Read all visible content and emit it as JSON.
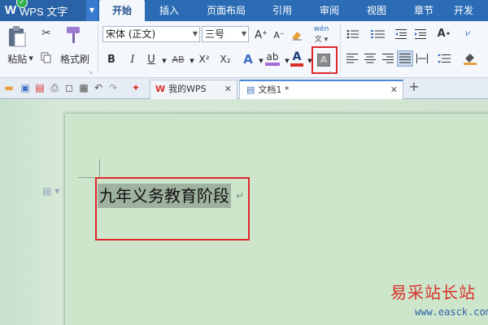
{
  "app": {
    "title": "WPS 文字",
    "logo": "W"
  },
  "menu_tabs": [
    "开始",
    "插入",
    "页面布局",
    "引用",
    "审阅",
    "视图",
    "章节",
    "开发"
  ],
  "active_tab": "开始",
  "ribbon": {
    "paste_label": "粘贴",
    "format_painter_label": "格式刷",
    "font_name": "宋体 (正文)",
    "font_size": "三号",
    "grow_font": "A⁺",
    "shrink_font": "A⁻",
    "pinyin_label": "wén",
    "bold": "B",
    "italic": "I",
    "underline": "U",
    "strikethrough": "AB",
    "superscript": "X²",
    "subscript": "X₂",
    "text_effect": "A",
    "highlight": "ab",
    "font_color": "A",
    "char_shading": "A"
  },
  "doc_tabs": [
    {
      "label": "我的WPS",
      "active": false
    },
    {
      "label": "文档1 *",
      "active": true
    }
  ],
  "add_tab": "+",
  "document": {
    "selected_text": "九年义务教育阶段",
    "paragraph_mark": "↵"
  },
  "watermark": {
    "title": "易采站长站",
    "url": "www.easck.com"
  },
  "colors": {
    "menubar": "#2b6cb4",
    "highlight_box": "#e0262b",
    "page": "#cde6cb"
  }
}
